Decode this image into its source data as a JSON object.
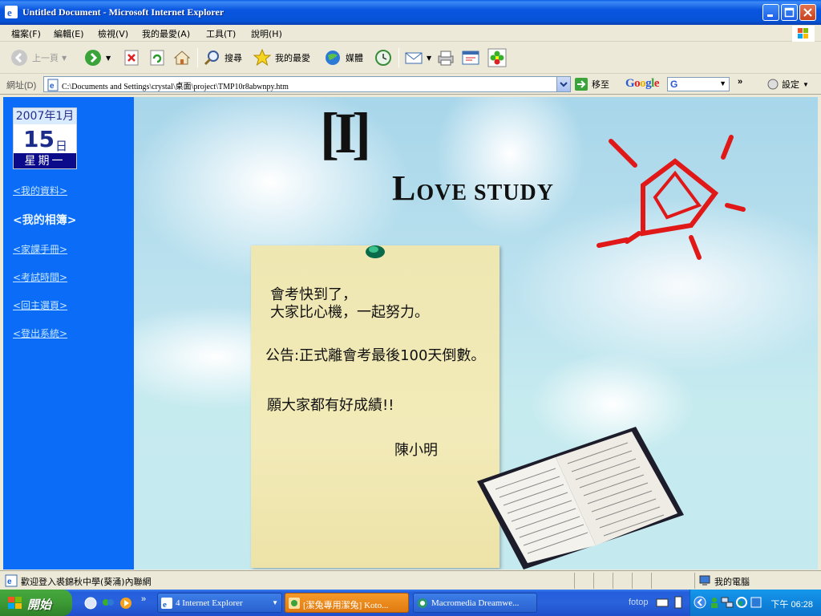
{
  "window": {
    "title": "Untitled Document - Microsoft Internet Explorer"
  },
  "menu": {
    "items": [
      "檔案(F)",
      "編輯(E)",
      "檢視(V)",
      "我的最愛(A)",
      "工具(T)",
      "說明(H)"
    ]
  },
  "toolbar": {
    "back_label": "上一頁",
    "search_label": "搜尋",
    "favorites_label": "我的最愛",
    "media_label": "媒體"
  },
  "addressbar": {
    "label": "網址(D)",
    "url": "C:\\Documents and Settings\\crystal\\桌面\\project\\TMP10r8abwnpy.htm",
    "go_label": "移至",
    "google_label": "Google",
    "google_input": "G",
    "settings_label": "設定"
  },
  "sidebar": {
    "calendar": {
      "year_month": "2007年1月",
      "day": "15",
      "day_suffix": "日",
      "weekday": "星期一"
    },
    "links": [
      "<我的資料>",
      "<我的相簿>",
      "<家課手冊>",
      "<考試時間>",
      "<回主選頁>",
      "<登出系統>"
    ]
  },
  "main": {
    "bracket_text": "[I]",
    "headline_cap": "L",
    "headline_rest": "OVE STUDY",
    "note": {
      "line1": "會考快到了，",
      "line2": "大家比心機，一起努力。",
      "line3": "公告:正式離會考最後100天倒數。",
      "line4": "願大家都有好成績!!",
      "signature": "陳小明"
    }
  },
  "statusbar": {
    "message": "歡迎登入裘錦秋中學(葵涌)內聯網",
    "zone": "我的電腦"
  },
  "taskbar": {
    "start_label": "開始",
    "tasks": [
      "4 Internet Explorer",
      "[潔兔專用潔兔] Koto...",
      "Macromedia Dreamwe..."
    ],
    "fotop": "fotop",
    "clock": "下午 06:28"
  },
  "colors": {
    "sidebar_bg": "#0a6cf7",
    "note_bg": "#f2eab8",
    "titlebar": "#0653d6"
  }
}
